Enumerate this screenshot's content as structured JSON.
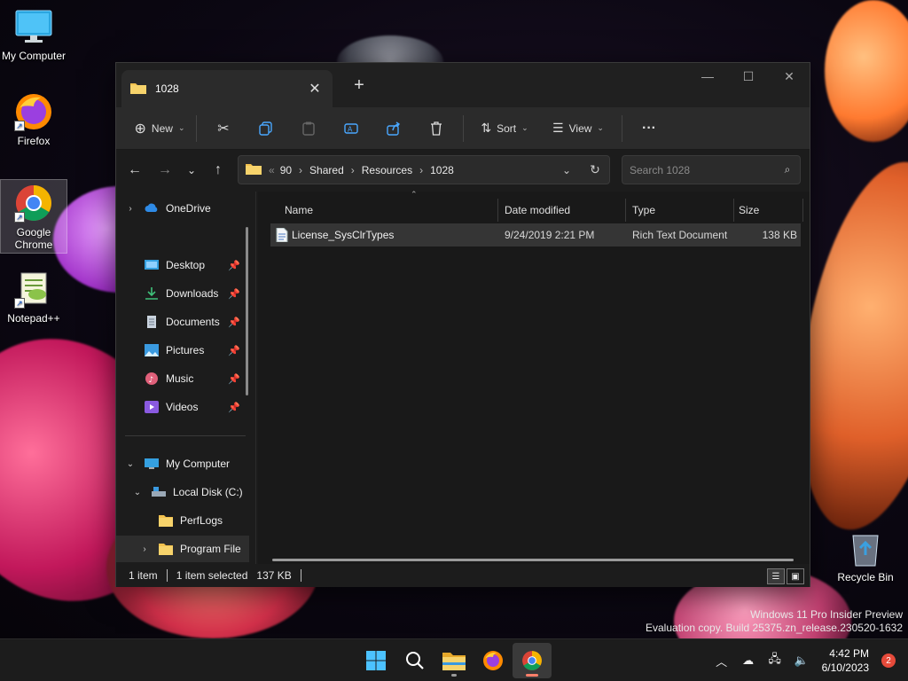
{
  "desktop": {
    "icons": [
      {
        "label": "My Computer"
      },
      {
        "label": "Firefox"
      },
      {
        "label": "Google Chrome"
      },
      {
        "label": "Notepad++"
      },
      {
        "label": "Recycle Bin"
      }
    ],
    "watermark": {
      "line1": "Windows 11 Pro Insider Preview",
      "line2": "Evaluation copy. Build 25375.zn_release.230520-1632"
    }
  },
  "window": {
    "tab_title": "1028",
    "new_tab": "+",
    "controls": {
      "minimize": "—",
      "maximize": "☐",
      "close": "✕"
    },
    "toolbar": {
      "new_label": "New",
      "sort_label": "Sort",
      "view_label": "View",
      "more_label": "···"
    },
    "breadcrumb": {
      "overflow": "«",
      "parts": [
        "90",
        "Shared",
        "Resources",
        "1028"
      ],
      "separator": "›"
    },
    "search": {
      "placeholder": "Search 1028"
    },
    "nav": {
      "onedrive": "OneDrive",
      "quick": [
        "Desktop",
        "Downloads",
        "Documents",
        "Pictures",
        "Music",
        "Videos"
      ],
      "my_computer": "My Computer",
      "local_disk": "Local Disk (C:)",
      "perflogs": "PerfLogs",
      "program_files": "Program File"
    },
    "columns": {
      "name": "Name",
      "date": "Date modified",
      "type": "Type",
      "size": "Size"
    },
    "files": [
      {
        "name": "License_SysClrTypes",
        "date": "9/24/2019 2:21 PM",
        "type": "Rich Text Document",
        "size": "138 KB"
      }
    ],
    "status": {
      "count": "1 item",
      "selected": "1 item selected",
      "size": "137 KB"
    }
  },
  "taskbar": {
    "apps": [
      "start-icon",
      "search-icon",
      "file-explorer-icon",
      "firefox-icon",
      "chrome-icon"
    ],
    "clock_time": "4:42 PM",
    "clock_date": "6/10/2023",
    "notification_count": "2"
  },
  "colors": {
    "window_bg": "#1c1c1c",
    "toolbar_bg": "#2b2b2b",
    "selected_row": "#353535",
    "folder_yellow": "#f2c14e",
    "taskbar_bg": "#1c1c1c"
  }
}
